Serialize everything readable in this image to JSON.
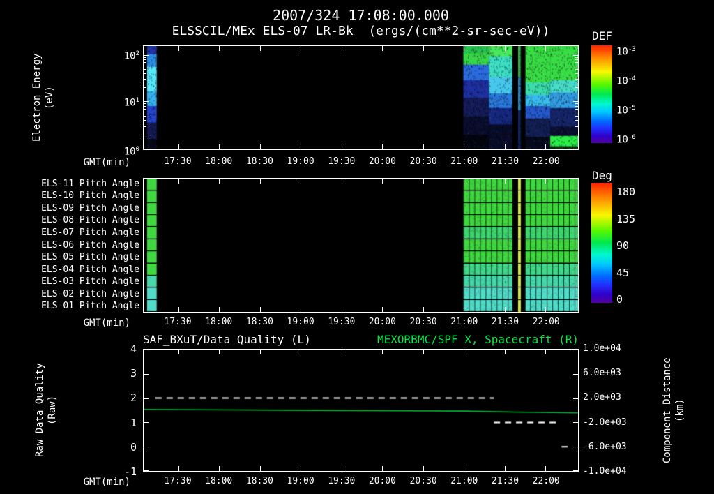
{
  "header": {
    "timestamp": "2007/324 17:08:00.000",
    "subtitle": "ELSSCIL/MEx ELS-07 LR-Bk  (ergs/(cm**2-sr-sec-eV))"
  },
  "time_axis": {
    "label": "GMT(min)",
    "ticks": [
      "17:30",
      "18:00",
      "18:30",
      "19:00",
      "19:30",
      "20:00",
      "20:30",
      "21:00",
      "21:30",
      "22:00"
    ],
    "first_tick_frac": 0.08,
    "tick_step_frac": 0.0939
  },
  "top_panel": {
    "ylabel_line1": "Electron Energy",
    "ylabel_line2": "(eV)",
    "ytick_exponents": [
      "2",
      "1",
      "0"
    ],
    "colorbar_title": "DEF",
    "colorbar_exponents": [
      "-3",
      "-4",
      "-5",
      "-6"
    ]
  },
  "pitch_panel": {
    "colorbar_title": "Deg",
    "colorbar_ticks": [
      "180",
      "135",
      "90",
      "45",
      "0"
    ]
  },
  "bottom_panel": {
    "left_title": "SAF_BXuT/Data Quality (L)",
    "right_title": "MEXORBMC/SPF X, Spacecraft (R)",
    "ylabel_left_line1": "Raw Data Quality",
    "ylabel_left_line2": "(Raw)",
    "ylabel_right_line1": "Component Distance",
    "ylabel_right_line2": "(km)",
    "left_ticks": [
      "4",
      "3",
      "2",
      "1",
      "0",
      "-1"
    ],
    "right_ticks": [
      "1.0e+04",
      "6.0e+03",
      "2.0e+03",
      "-2.0e+03",
      "-6.0e+03",
      "-1.0e+04"
    ]
  },
  "colors": {
    "background": "#000000",
    "text": "#ffffff",
    "title_green": "#00e646",
    "line_green": "#00b438",
    "rainbow": [
      "#ff2000 0%",
      "#ff8c00 13%",
      "#f8f800 27%",
      "#58f800 40%",
      "#00e850 50%",
      "#00f8d0 60%",
      "#00c8ff 68%",
      "#0070ff 77%",
      "#2030ff 85%",
      "#3000c8 93%",
      "#5000a0 100%"
    ]
  },
  "chart_data": [
    {
      "type": "heatmap",
      "title": "ELSSCIL/MEx ELS-07 LR-Bk",
      "units": "ergs/(cm**2-sr-sec-eV)",
      "x_label": "GMT(min)",
      "x_start": "17:04",
      "x_end": "22:24",
      "y_label": "Electron Energy (eV)",
      "y_scale": "log",
      "y_range": [
        1,
        150
      ],
      "colorbar": {
        "label": "DEF",
        "scale": "log",
        "min": 1e-06,
        "max": 0.001
      },
      "coverage_notes": [
        "narrow flux burst near 17:08-17:15",
        "no data 17:15-21:00",
        "continuous data 21:00 to end with two black dropouts near 21:36-21:42",
        "bright low-energy (1-3 eV) green band after ~22:05"
      ],
      "segments": [
        {
          "x0": 0.008,
          "x1": 0.03,
          "bands": [
            [
              "#2233aa",
              0,
              0.08
            ],
            [
              "#2b8fe8",
              0.08,
              0.2
            ],
            [
              "#55e8ff",
              0.2,
              0.44
            ],
            [
              "#35b2f0",
              0.44,
              0.58
            ],
            [
              "#2344cc",
              0.58,
              0.74
            ],
            [
              "#141a55",
              0.74,
              0.9
            ],
            [
              "#060818",
              0.9,
              1
            ]
          ]
        },
        {
          "x0": 0.736,
          "x1": 0.795,
          "bands": [
            [
              "#27c24f",
              0,
              0.07
            ],
            [
              "#37d646",
              0.07,
              0.18
            ],
            [
              "#2a6ade",
              0.18,
              0.33
            ],
            [
              "#1d2f9e",
              0.33,
              0.5
            ],
            [
              "#141b58",
              0.5,
              0.68
            ],
            [
              "#0a0d2e",
              0.68,
              0.86
            ],
            [
              "#040410",
              0.86,
              1
            ]
          ]
        },
        {
          "x0": 0.795,
          "x1": 0.849,
          "bands": [
            [
              "#49e85e",
              0,
              0.1
            ],
            [
              "#3cdfc4",
              0.1,
              0.3
            ],
            [
              "#46c8ee",
              0.3,
              0.46
            ],
            [
              "#2a79dd",
              0.46,
              0.6
            ],
            [
              "#15277e",
              0.6,
              0.76
            ],
            [
              "#080c28",
              0.76,
              1
            ]
          ]
        },
        {
          "x0": 0.849,
          "x1": 0.862,
          "bands": [
            [
              "#000000",
              0,
              1
            ]
          ]
        },
        {
          "x0": 0.862,
          "x1": 0.868,
          "bands": [
            [
              "#36b74a",
              0,
              0.3
            ],
            [
              "#2a8ecc",
              0.3,
              0.62
            ],
            [
              "#122468",
              0.62,
              1
            ]
          ]
        },
        {
          "x0": 0.868,
          "x1": 0.879,
          "bands": [
            [
              "#000000",
              0,
              1
            ]
          ]
        },
        {
          "x0": 0.879,
          "x1": 0.936,
          "bands": [
            [
              "#38dc45",
              0,
              0.35
            ],
            [
              "#3adcaa",
              0.35,
              0.47
            ],
            [
              "#38bcee",
              0.47,
              0.58
            ],
            [
              "#2458cc",
              0.58,
              0.7
            ],
            [
              "#121e52",
              0.7,
              0.88
            ],
            [
              "#070a1c",
              0.88,
              1
            ]
          ]
        },
        {
          "x0": 0.936,
          "x1": 1.0,
          "bands": [
            [
              "#38dc45",
              0,
              0.33
            ],
            [
              "#46dcc8",
              0.33,
              0.45
            ],
            [
              "#329ae0",
              0.45,
              0.6
            ],
            [
              "#16246a",
              0.6,
              0.78
            ],
            [
              "#0a0f30",
              0.78,
              0.87
            ],
            [
              "#2aee47",
              0.87,
              0.97
            ],
            [
              "#0c3614",
              0.97,
              1
            ]
          ]
        }
      ]
    },
    {
      "type": "heatmap",
      "title": "ELS Pitch Angle panels",
      "x_label": "GMT(min)",
      "colorbar": {
        "label": "Deg",
        "min": 0,
        "max": 180
      },
      "stripe_x0": 0.008,
      "stripe_x1": 0.03,
      "data_x0": 0.736,
      "grid_step": 0.0128,
      "gaps": [
        [
          0.849,
          0.862
        ],
        [
          0.868,
          0.879
        ]
      ],
      "highlight": {
        "x0": 0.862,
        "x1": 0.868,
        "color": "#dce83c"
      },
      "rows": [
        {
          "label": "ELS-11 Pitch Angle",
          "approx_deg": 95,
          "stripe": "#40d840",
          "main": "#40d840"
        },
        {
          "label": "ELS-10 Pitch Angle",
          "approx_deg": 95,
          "stripe": "#40d840",
          "main": "#40d840"
        },
        {
          "label": "ELS-09 Pitch Angle",
          "approx_deg": 95,
          "stripe": "#40d840",
          "main": "#40d840"
        },
        {
          "label": "ELS-08 Pitch Angle",
          "approx_deg": 95,
          "stripe": "#40d840",
          "main": "#40d840"
        },
        {
          "label": "ELS-07 Pitch Angle",
          "approx_deg": 90,
          "stripe": "#40d840",
          "main": "#3ed46e"
        },
        {
          "label": "ELS-06 Pitch Angle",
          "approx_deg": 90,
          "stripe": "#40d840",
          "main": "#40d840"
        },
        {
          "label": "ELS-05 Pitch Angle",
          "approx_deg": 90,
          "stripe": "#40d840",
          "main": "#40d840"
        },
        {
          "label": "ELS-04 Pitch Angle",
          "approx_deg": 80,
          "stripe": "#40d840",
          "main": "#42d88a"
        },
        {
          "label": "ELS-03 Pitch Angle",
          "approx_deg": 70,
          "stripe": "#45d8a8",
          "main": "#45d8a8"
        },
        {
          "label": "ELS-02 Pitch Angle",
          "approx_deg": 60,
          "stripe": "#50dcc8",
          "main": "#50dcc8"
        },
        {
          "label": "ELS-01 Pitch Angle",
          "approx_deg": 55,
          "stripe": "#50dcc8",
          "main": "#50dcc8"
        }
      ]
    },
    {
      "type": "line",
      "left_title": "SAF_BXuT/Data Quality (L)",
      "right_title": "MEXORBMC/SPF X, Spacecraft (R)",
      "x_label": "GMT(min)",
      "left_axis": {
        "label": "Raw Data Quality (Raw)",
        "range": [
          -1,
          4
        ],
        "ticks": [
          4,
          3,
          2,
          1,
          0,
          -1
        ]
      },
      "right_axis": {
        "label": "Component Distance (km)",
        "range": [
          -10000,
          10000
        ],
        "ticks": [
          10000,
          6000,
          2000,
          -2000,
          -6000,
          -10000
        ]
      },
      "series": [
        {
          "name": "SAF_BXuT/Data Quality (L)",
          "axis": "left",
          "color": "#ffffff",
          "style": "dashed",
          "segments": [
            {
              "x0": 0.027,
              "x1": 0.806,
              "value": 2
            },
            {
              "x0": 0.806,
              "x1": 0.952,
              "value": 1
            },
            {
              "x0": 0.962,
              "x1": 0.988,
              "value": 0
            }
          ]
        },
        {
          "name": "MEXORBMC/SPF X, Spacecraft (R)",
          "axis": "right",
          "color": "#00b438",
          "style": "solid",
          "points": [
            [
              0.0,
              150
            ],
            [
              0.2,
              60
            ],
            [
              0.4,
              -20
            ],
            [
              0.6,
              -80
            ],
            [
              0.74,
              -130
            ],
            [
              0.85,
              -280
            ],
            [
              1.0,
              -430
            ]
          ]
        }
      ]
    }
  ]
}
